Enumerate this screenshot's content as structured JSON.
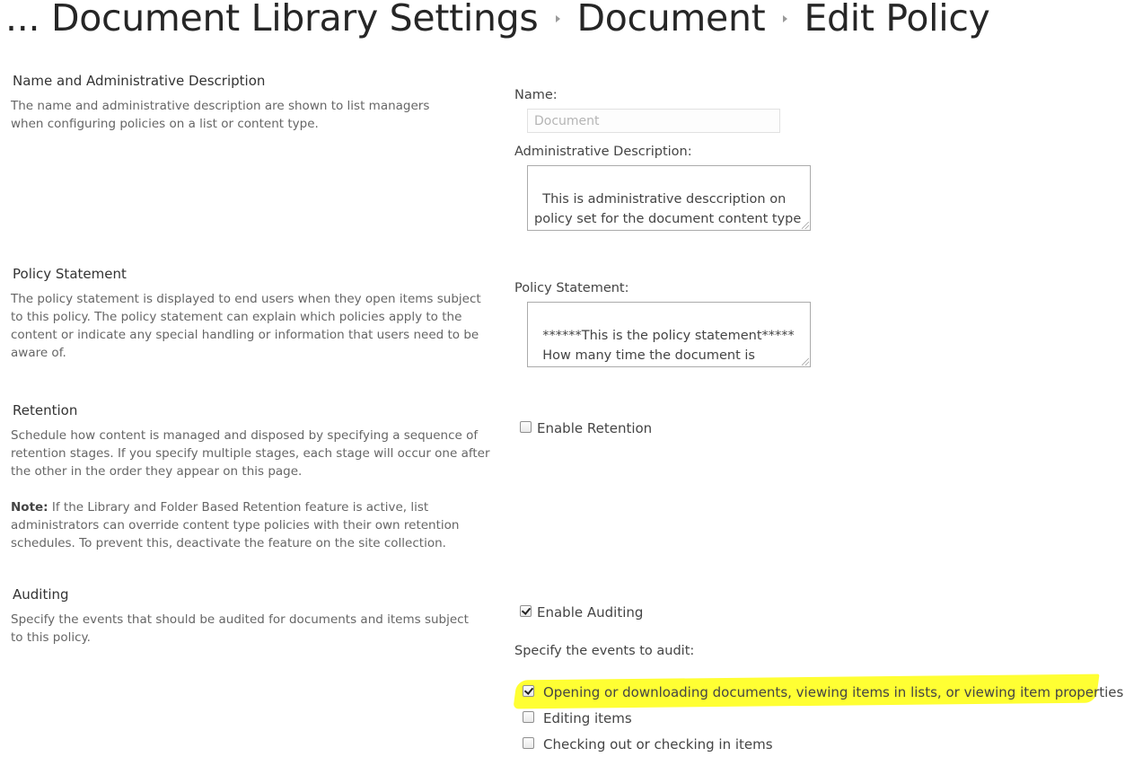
{
  "header": {
    "ellipsis": "...",
    "crumbs": [
      "Document Library Settings",
      "Document",
      "Edit Policy"
    ]
  },
  "name_section": {
    "title": "Name and Administrative Description",
    "description": "The name and administrative description are shown to list managers when configuring policies on a list or content type.",
    "name_label": "Name:",
    "name_value": "Document",
    "admin_label": "Administrative Description:",
    "admin_value": "This is administrative desccription on policy set for the document content type"
  },
  "policy_section": {
    "title": "Policy Statement",
    "description": "The policy statement is displayed to end users when they open items subject to this policy. The policy statement can explain which policies apply to the content or indicate any special handling or information that users need to be aware of.",
    "label": "Policy Statement:",
    "value": "******This is the policy statement*****\n  How many time the document is opened."
  },
  "retention_section": {
    "title": "Retention",
    "description": "Schedule how content is managed and disposed by specifying a sequence of retention stages. If you specify multiple stages, each stage will occur one after the other in the order they appear on this page.",
    "note_label": "Note:",
    "note_text": " If the Library and Folder Based Retention feature is active, list administrators can override content type policies with their own retention schedules.  To prevent this, deactivate the feature on the site collection.",
    "enable_label": "Enable Retention",
    "enabled": false
  },
  "auditing_section": {
    "title": "Auditing",
    "description": "Specify the events that should be audited for documents and items subject to this policy.",
    "enable_label": "Enable Auditing",
    "enabled": true,
    "events_label": "Specify the events to audit:",
    "events": [
      {
        "label": "Opening or downloading documents, viewing items in lists, or viewing item properties",
        "checked": true
      },
      {
        "label": "Editing items",
        "checked": false
      },
      {
        "label": "Checking out or checking in items",
        "checked": false
      }
    ]
  },
  "colors": {
    "highlight": "#ffff33",
    "title_text": "#262626",
    "description_text": "#666666"
  }
}
